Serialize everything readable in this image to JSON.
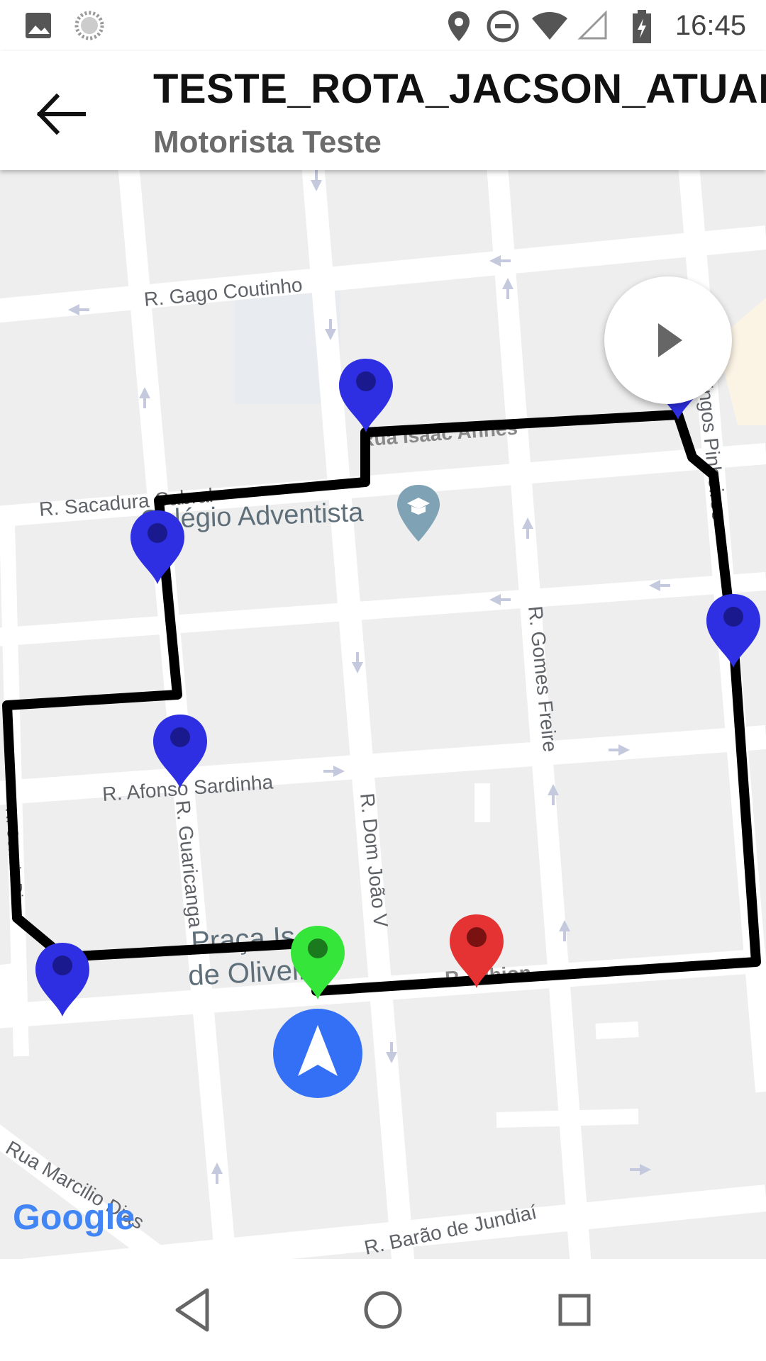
{
  "status_bar": {
    "time": "16:45",
    "icons": [
      "image-icon",
      "sync-icon",
      "location-icon",
      "do-not-disturb-icon",
      "wifi-icon",
      "signal-icon",
      "battery-charging-icon"
    ]
  },
  "header": {
    "title": "TESTE_ROTA_JACSON_ATUAL",
    "subtitle": "Motorista Teste",
    "back_icon": "arrow-back-icon",
    "play_icon": "play-icon"
  },
  "map": {
    "streets": {
      "gago": "R. Gago Coutinho",
      "sacadura": "R. Sacadura Cabral",
      "isaac": "Rua Isaac Annes",
      "domingos": "R. Domingos Pinheiros",
      "afonso": "R. Afonso Sardinha",
      "guaricanga": "R. Guaricanga",
      "domjoao": "R. Dom João V",
      "gomes": "R. Gomes Freire",
      "albion": "R. Albion",
      "marcilio": "Rua Marcilio Dias",
      "barao": "R. Barão de Jundiaí",
      "west": "R. Correia Dias"
    },
    "places": {
      "school": "Colégio Adventista",
      "praca_line1": "Praça Is",
      "praca_line2": "de Oliveira"
    },
    "attribution": "Google",
    "colors": {
      "route": "#000000",
      "stop_marker": "#2e2fe3",
      "start_marker": "#35e53a",
      "end_marker": "#e53232",
      "location_button": "#3370f5"
    }
  },
  "nav_bar": {
    "back": "nav-back-icon",
    "home": "nav-home-icon",
    "recents": "nav-recents-icon"
  }
}
